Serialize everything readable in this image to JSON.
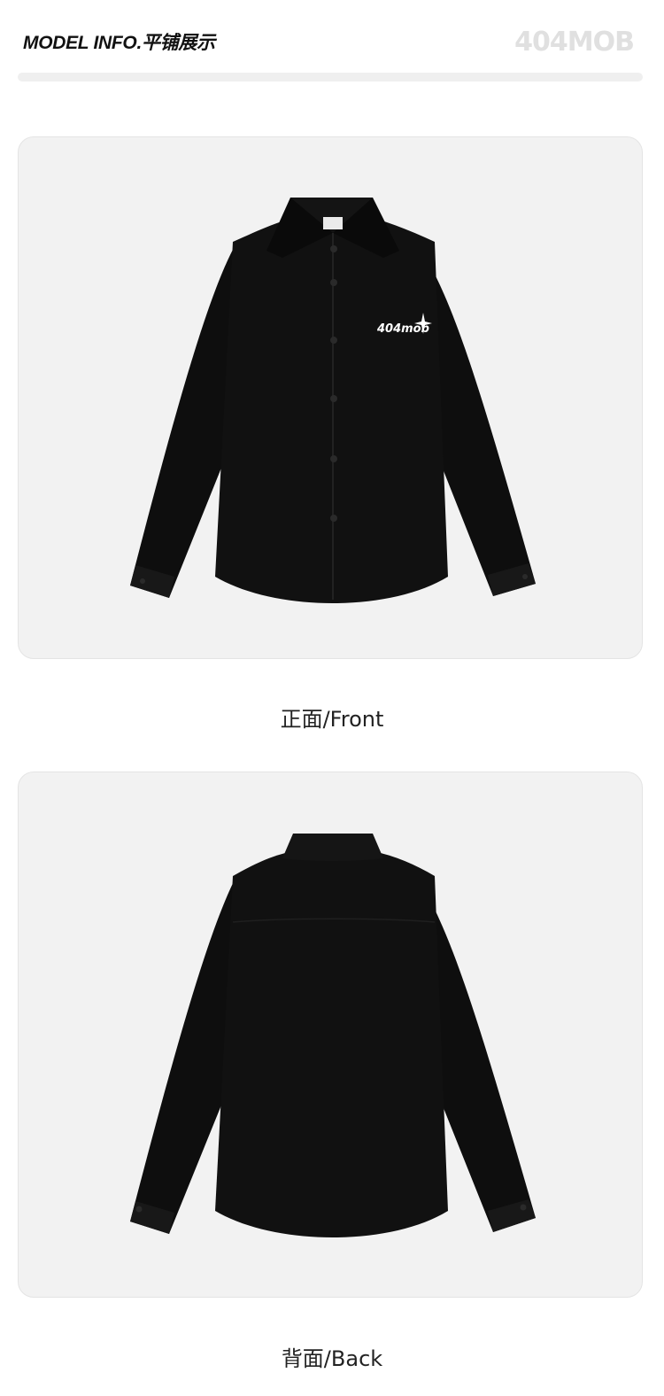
{
  "header": {
    "title": "MODEL INFO.平铺展示",
    "brand": "404MOB"
  },
  "front": {
    "chest_print": "404mob",
    "caption": "正面/Front"
  },
  "back": {
    "caption": "背面/Back"
  },
  "colors": {
    "shirt": "#0d0d0d",
    "panel_bg": "#f2f2f2",
    "print": "#ffffff"
  }
}
